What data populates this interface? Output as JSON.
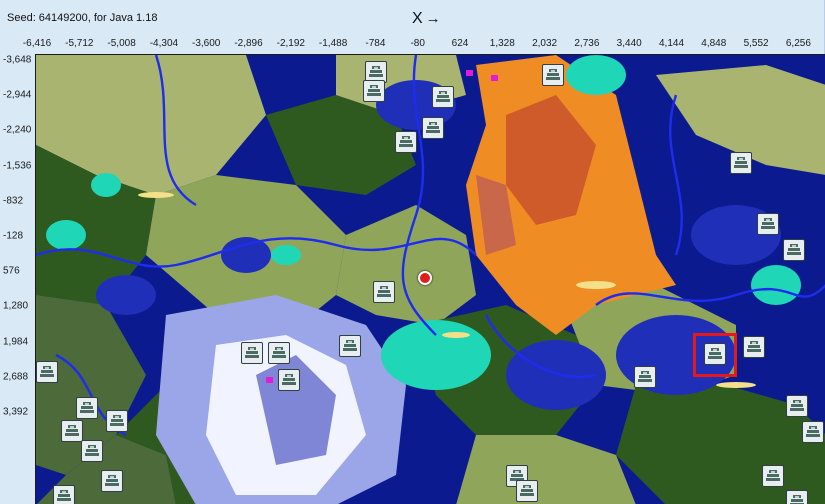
{
  "seed_text": "Seed: 64149200, for Java 1.18",
  "x_axis_label": "X",
  "x_axis_arrow": "→",
  "x_ticks": [
    "-6,416",
    "-5,712",
    "-5,008",
    "-4,304",
    "-3,600",
    "-2,896",
    "-2,192",
    "-1,488",
    "-784",
    "-80",
    "624",
    "1,328",
    "2,032",
    "2,736",
    "3,440",
    "4,144",
    "4,848",
    "5,552",
    "6,256"
  ],
  "y_ticks": [
    "-3,648",
    "-2,944",
    "-2,240",
    "-1,536",
    "-832",
    "-128",
    "576",
    "1,280",
    "1,984",
    "2,688",
    "3,392"
  ],
  "colors": {
    "ocean_deep": "#0c1a8f",
    "ocean": "#1f2fb8",
    "river": "#1e2cf0",
    "forest": "#2f5a1f",
    "plains": "#8fa65a",
    "savanna": "#a9b470",
    "swamp": "#4d6a3a",
    "badlands": "#f08c24",
    "badlands_red": "#d05b2a",
    "snow": "#f1f4ff",
    "ice": "#9aa6e8",
    "lush": "#1fd7b7",
    "beach": "#f5e08a",
    "mushroom": "#e21bd6"
  },
  "markers": [
    {
      "name": "ocean-monument-icon",
      "icon": "ocean-monument-icon"
    },
    {
      "name": "ocean-monument-icon",
      "icon": "ocean-monument-icon"
    },
    {
      "name": "ocean-monument-icon",
      "icon": "ocean-monument-icon"
    },
    {
      "name": "ocean-monument-icon",
      "icon": "ocean-monument-icon"
    },
    {
      "name": "ocean-monument-icon",
      "icon": "ocean-monument-icon"
    },
    {
      "name": "ocean-monument-icon",
      "icon": "ocean-monument-icon"
    },
    {
      "name": "ocean-monument-icon",
      "icon": "ocean-monument-icon"
    },
    {
      "name": "ocean-monument-icon",
      "icon": "ocean-monument-icon"
    },
    {
      "name": "ocean-monument-icon",
      "icon": "ocean-monument-icon"
    },
    {
      "name": "ocean-monument-icon",
      "icon": "ocean-monument-icon"
    },
    {
      "name": "ocean-monument-icon",
      "icon": "ocean-monument-icon"
    },
    {
      "name": "ocean-monument-icon",
      "icon": "ocean-monument-icon"
    },
    {
      "name": "ocean-monument-icon",
      "icon": "ocean-monument-icon"
    },
    {
      "name": "ocean-monument-icon",
      "icon": "ocean-monument-icon"
    },
    {
      "name": "ocean-monument-icon",
      "icon": "ocean-monument-icon"
    },
    {
      "name": "ocean-monument-icon",
      "icon": "ocean-monument-icon"
    },
    {
      "name": "ocean-monument-icon",
      "icon": "ocean-monument-icon"
    },
    {
      "name": "ocean-monument-icon",
      "icon": "ocean-monument-icon"
    },
    {
      "name": "ocean-monument-icon",
      "icon": "ocean-monument-icon"
    },
    {
      "name": "ocean-monument-icon",
      "icon": "ocean-monument-icon"
    },
    {
      "name": "ocean-monument-icon",
      "icon": "ocean-monument-icon"
    },
    {
      "name": "ocean-monument-icon",
      "icon": "ocean-monument-icon"
    },
    {
      "name": "ocean-monument-icon",
      "icon": "ocean-monument-icon"
    },
    {
      "name": "ocean-monument-icon",
      "icon": "ocean-monument-icon"
    },
    {
      "name": "ocean-monument-icon",
      "icon": "ocean-monument-icon"
    },
    {
      "name": "ocean-monument-icon",
      "icon": "ocean-monument-icon"
    },
    {
      "name": "ocean-monument-icon",
      "icon": "ocean-monument-icon"
    },
    {
      "name": "ocean-monument-icon",
      "icon": "ocean-monument-icon"
    },
    {
      "name": "ocean-monument-icon",
      "icon": "ocean-monument-icon"
    },
    {
      "name": "ocean-monument-icon",
      "icon": "ocean-monument-icon"
    }
  ],
  "highlight_color": "#e41a1a"
}
